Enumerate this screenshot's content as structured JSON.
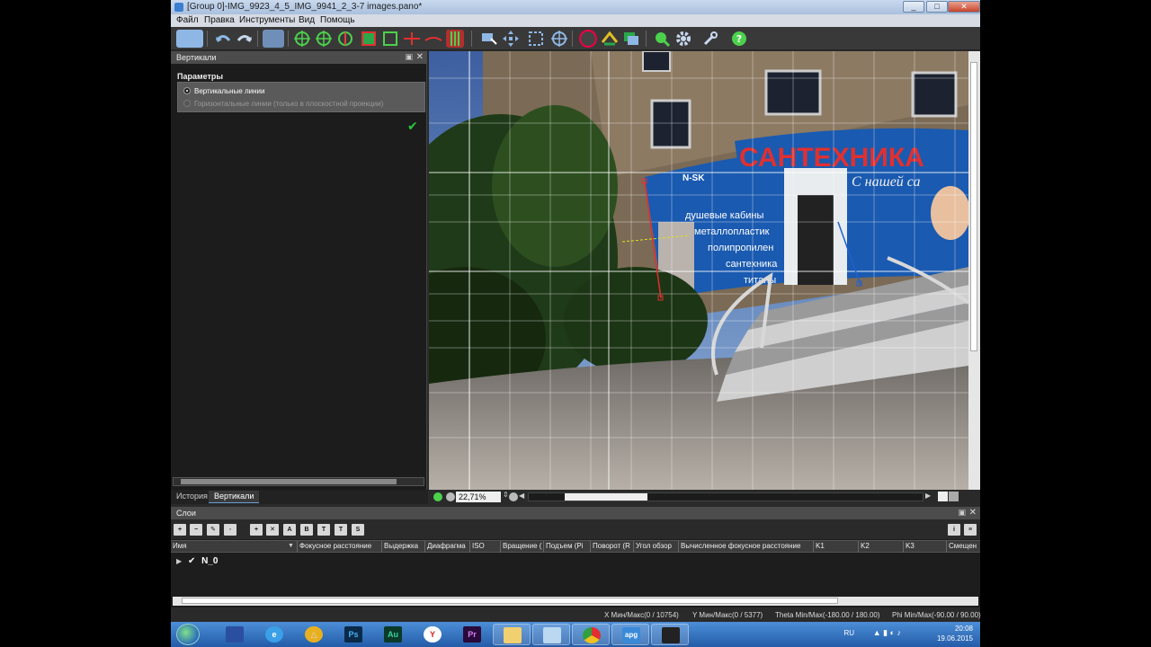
{
  "window": {
    "title": "[Group 0]-IMG_9923_4_5_IMG_9941_2_3-7 images.pano*"
  },
  "menu": {
    "items": [
      "Файл",
      "Правка",
      "Инструменты",
      "Вид",
      "Помощь"
    ]
  },
  "left_panel": {
    "title": "Вертикали",
    "params_title": "Параметры",
    "options": [
      {
        "label": "Вертикальные линии",
        "selected": true
      },
      {
        "label": "Горизонтальные линии (только в плоскостной проекции)",
        "selected": false
      }
    ],
    "tabs": [
      "История",
      "Вертикали"
    ],
    "active_tab": "Вертикали"
  },
  "viewer": {
    "zoom": "22,71%",
    "image_description": "Panorama photo: building corner with a blue shop sign, trees on the left, steps with railings, paved sidewalk",
    "sign_text": "САНТЕХНИКА",
    "sign_sub": "С нашей са",
    "banner_lines": [
      "душевые кабины",
      "металлопластик",
      "полипропилен",
      "сантехника",
      "титаны"
    ],
    "brand": "N-SK"
  },
  "layers": {
    "title": "Слои",
    "tool_letters": [
      "A",
      "B",
      "T",
      "T",
      "S"
    ],
    "columns": [
      "Имя",
      "Фокусное расстояние",
      "Выдержка",
      "Диафрагма",
      "ISO",
      "Вращение (",
      "Подъем (Pi",
      "Поворот (R",
      "Угол обзор",
      "Вычисленное фокусное расстояние",
      "K1",
      "K2",
      "K3",
      "Смещен"
    ],
    "rows": [
      {
        "name": "N_0",
        "checked": true
      }
    ]
  },
  "status": {
    "x": "X Мин/Макс(0 / 10754)",
    "y": "Y Мин/Макс(0 / 5377)",
    "theta": "Theta Min/Max(-180.00 / 180.00)",
    "phi": "Phi Min/Max(-90.00 / 90.00)"
  },
  "taskbar": {
    "apps": [
      "explorer-save",
      "ie",
      "autopano-triangle",
      "Ps",
      "Au",
      "yandex",
      "Pr",
      "folder",
      "remote",
      "chrome",
      "apg",
      "media"
    ],
    "labels": {
      "Ps": "Ps",
      "Au": "Au",
      "Pr": "Pr",
      "apg": "apg"
    },
    "lang": "RU",
    "time": "20:08",
    "date": "19.06.2015"
  },
  "colors": {
    "accent": "#2f6fc0",
    "bg": "#2b2b2b",
    "check": "#27c93f"
  }
}
